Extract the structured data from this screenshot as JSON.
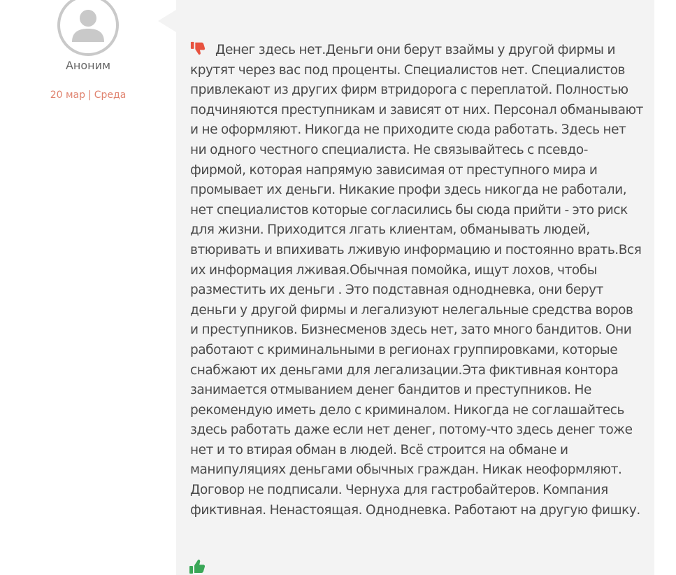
{
  "author": {
    "name": "Аноним",
    "avatar_icon": "user-silhouette-icon"
  },
  "date": {
    "day": "20 мар",
    "separator": "|",
    "weekday": "Среда"
  },
  "review": {
    "negative_icon": "thumbs-down-icon",
    "negative_text": "Денег здесь нет.Деньги они берут взаймы у другой фирмы и крутят через вас под проценты. Специалистов нет. Специалистов привлекают из других фирм втридорога с переплатой. Полностью подчиняются преступникам и зависят от них. Персонал обманывают и не оформляют. Никогда не приходите сюда работать. Здесь нет ни одного честного специалиста. Не связывайтесь с псевдо-фирмой, которая напрямую зависимая от преступного мира и промывает их деньги. Никакие профи здесь никогда не работали, нет специалистов которые согласились бы сюда прийти - это риск для жизни. Приходится лгать клиентам, обманывать людей, втюривать и впихивать лживую информацию и постоянно врать.Вся их информация лживая.Обычная помойка, ищут лохов, чтобы разместить их деньги . Это подставная однодневка, они берут деньги у другой фирмы и легализуют нелегальные средства воров и преступников. Бизнесменов здесь нет, зато много бандитов. Они работают с криминальными в регионах группировками, которые снабжают их деньгами для легализации.Эта фиктивная контора занимается отмыванием денег бандитов и преступников. Не рекомендую иметь дело с криминалом. Никогда не соглашайтесь здесь работать даже если нет денег, потому-что здесь денег тоже нет и то втирая обман в людей. Всё строится на обмане и манипуляциях деньгами обычных граждан. Никак неоформляют. Договор не подписали. Чернуха для гастробайтеров. Компания фиктивная. Ненастоящая. Однодневка. Работают на другую фишку.",
    "positive_icon": "thumbs-up-icon"
  },
  "colors": {
    "negative": "#e8523f",
    "positive": "#3aa757",
    "date_accent": "#e0836f",
    "bubble_bg": "#f3f3f3"
  }
}
